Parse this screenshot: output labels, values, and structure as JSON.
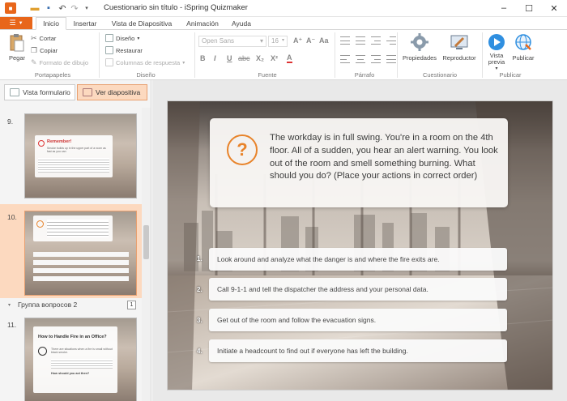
{
  "window": {
    "title": "Cuestionario sin título - iSpring Quizmaker",
    "controls": {
      "minimize": "–",
      "maximize": "☐",
      "close": "✕"
    }
  },
  "quick_access": [
    "app-icon",
    "open-icon",
    "save-icon",
    "undo-icon",
    "redo-icon",
    "customize-icon"
  ],
  "file_button": {
    "label": "▼"
  },
  "tabs": [
    {
      "label": "Inicio",
      "active": true
    },
    {
      "label": "Insertar"
    },
    {
      "label": "Vista de Diapositiva"
    },
    {
      "label": "Animación"
    },
    {
      "label": "Ayuda"
    }
  ],
  "ribbon": {
    "portapapeles": {
      "label": "Portapapeles",
      "paste": "Pegar",
      "cut": "Cortar",
      "copy": "Copiar",
      "format_painter": "Formato de dibujo"
    },
    "diseno": {
      "label": "Diseño",
      "design": "Diseño",
      "restore": "Restaurar",
      "columns": "Columnas de respuesta"
    },
    "fuente": {
      "label": "Fuente",
      "font_name": "Open Sans",
      "font_size": "16",
      "buttons": [
        "B",
        "I",
        "U",
        "abc",
        "X₂",
        "X²",
        "A",
        "A⁺",
        "A⁻",
        "Aa"
      ]
    },
    "parrafo": {
      "label": "Párrafo"
    },
    "cuestionario": {
      "label": "Cuestionario",
      "properties": "Propiedades",
      "player": "Reproductor"
    },
    "publicar": {
      "label": "Publicar",
      "preview": "Vista previa",
      "preview_caret": "▾",
      "publish": "Publicar"
    }
  },
  "view_buttons": {
    "form_view": "Vista formulario",
    "slide_view": "Ver diapositiva"
  },
  "slides": [
    {
      "num": "9.",
      "title": "Remember!",
      "text": "Smoke builds up in the upper part of a room as fast as you can"
    },
    {
      "num": "10.",
      "selected": true
    },
    {
      "group": "Группа вопросов 2",
      "count": "1"
    },
    {
      "num": "11.",
      "title": "How to Handle Fire in an Office?",
      "text": "There are situations when a fire is small without black smoke.",
      "text2": "How should you act then?"
    }
  ],
  "question": {
    "icon": "?",
    "text": "The workday is in full swing. You're in a room on the 4th floor. All of a sudden, you hear an alert warning. You look out of the room and smell something burning. What should you do? (Place your actions in correct order)"
  },
  "answers": [
    {
      "num": "1.",
      "text": "Look around and analyze what the danger is and where the fire exits are."
    },
    {
      "num": "2.",
      "text": "Call 9-1-1 and tell the dispatcher the address and your personal data."
    },
    {
      "num": "3.",
      "text": "Get out of the room and follow the evacuation signs."
    },
    {
      "num": "4.",
      "text": "Initiate a headcount to find out if everyone has left the building."
    }
  ],
  "colors": {
    "accent": "#e8661a",
    "question_icon": "#e8832a",
    "selected_thumb": "#fcd9bf"
  }
}
